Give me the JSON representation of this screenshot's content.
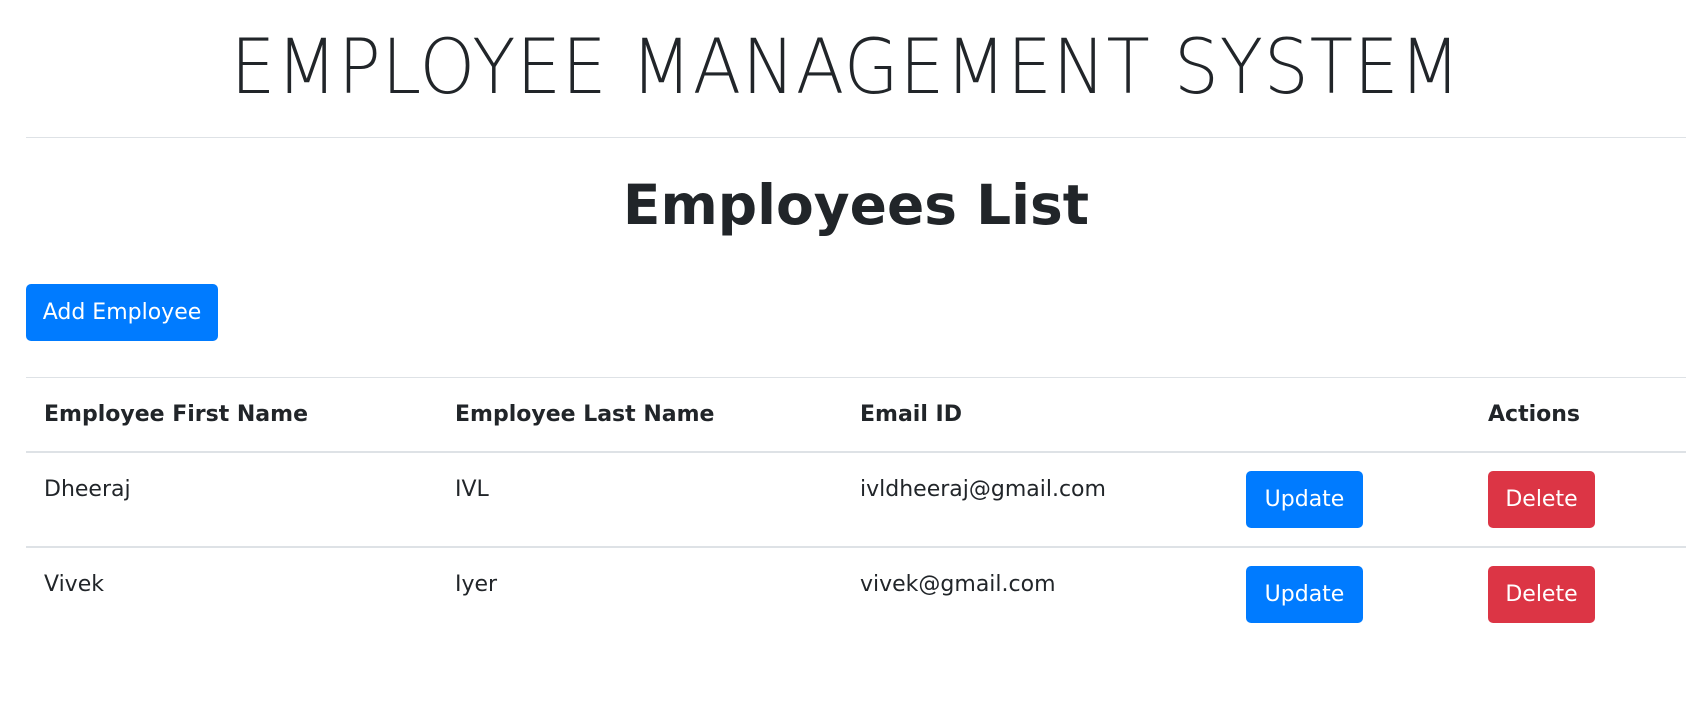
{
  "app": {
    "title": "EMPLOYEE MANAGEMENT SYSTEM"
  },
  "page": {
    "heading": "Employees List"
  },
  "toolbar": {
    "add_label": "Add Employee"
  },
  "table": {
    "headers": {
      "first_name": "Employee First Name",
      "last_name": "Employee Last Name",
      "email": "Email ID",
      "update": "",
      "actions": "Actions"
    },
    "rows": [
      {
        "first_name": "Dheeraj",
        "last_name": "IVL",
        "email": "ivldheeraj@gmail.com",
        "update_label": "Update",
        "delete_label": "Delete"
      },
      {
        "first_name": "Vivek",
        "last_name": "Iyer",
        "email": "vivek@gmail.com",
        "update_label": "Update",
        "delete_label": "Delete"
      }
    ]
  },
  "colors": {
    "primary": "#007bff",
    "danger": "#dc3545",
    "text": "#212529",
    "border": "#dee2e6"
  }
}
